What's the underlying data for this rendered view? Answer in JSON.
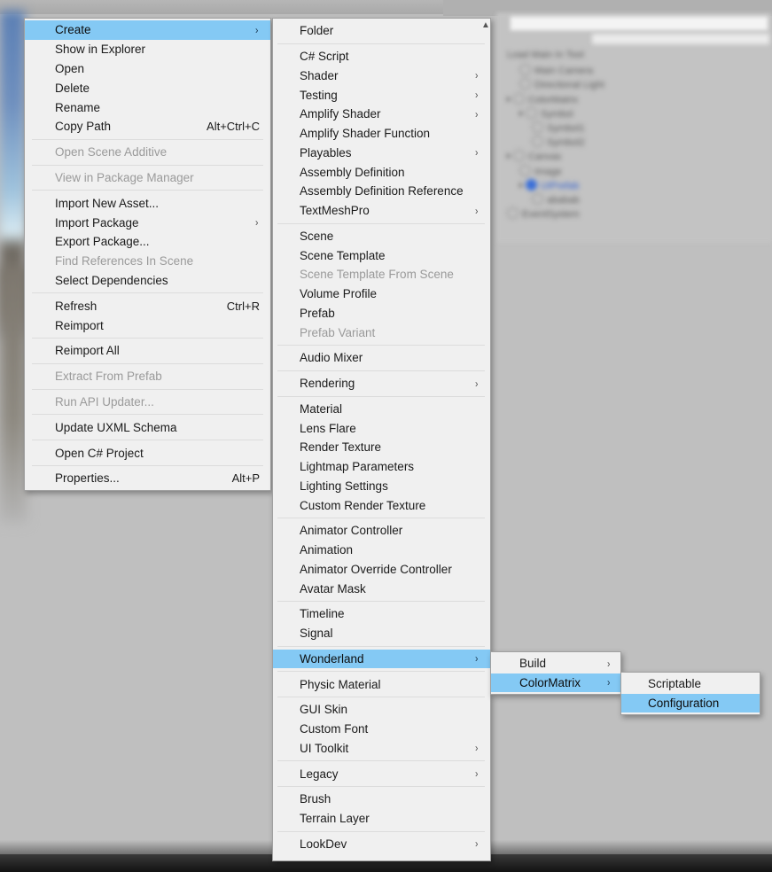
{
  "background": {
    "hierarchy_rows": [
      {
        "label": "Load Main In Tool",
        "indent": 0,
        "expand": false,
        "icon": false,
        "selected": false
      },
      {
        "label": "Main Camera",
        "indent": 1,
        "expand": false,
        "icon": true,
        "selected": false
      },
      {
        "label": "Directional Light",
        "indent": 1,
        "expand": false,
        "icon": true,
        "selected": false
      },
      {
        "label": "ColorMatrix",
        "indent": 0,
        "expand": true,
        "icon": true,
        "selected": false
      },
      {
        "label": "Symbol",
        "indent": 1,
        "expand": true,
        "icon": true,
        "selected": false
      },
      {
        "label": "Symbol1",
        "indent": 2,
        "expand": false,
        "icon": true,
        "selected": false
      },
      {
        "label": "Symbol2",
        "indent": 2,
        "expand": false,
        "icon": true,
        "selected": false
      },
      {
        "label": "Canvas",
        "indent": 0,
        "expand": true,
        "icon": true,
        "selected": false
      },
      {
        "label": "Image",
        "indent": 1,
        "expand": false,
        "icon": true,
        "selected": false
      },
      {
        "label": "UIPrefab",
        "indent": 1,
        "expand": true,
        "icon": true,
        "selected": true
      },
      {
        "label": "ababab",
        "indent": 2,
        "expand": false,
        "icon": true,
        "selected": false
      },
      {
        "label": "EventSystem",
        "indent": 0,
        "expand": false,
        "icon": true,
        "selected": false
      }
    ]
  },
  "colors": {
    "highlight": "#84c9f4",
    "menu_background": "#f0f0f0",
    "menu_border": "#a0a0a0",
    "text": "#1a1a1a",
    "text_disabled": "#9a9a9a",
    "separator": "#dcdcdc",
    "desktop_background": "#bfbfbf"
  },
  "icons": {
    "submenu_arrow": "submenu-arrow-icon",
    "scroll_up": "scroll-up-icon"
  },
  "glyphs": {
    "arrow": "›",
    "scroll_up": "▲"
  },
  "menu_asset": {
    "name": "Assets context menu",
    "items": [
      {
        "label": "Create",
        "highlighted": true,
        "submenu": true,
        "shortcut": "",
        "disabled": false
      },
      {
        "label": "Show in Explorer",
        "highlighted": false,
        "submenu": false,
        "shortcut": "",
        "disabled": false
      },
      {
        "label": "Open",
        "highlighted": false,
        "submenu": false,
        "shortcut": "",
        "disabled": false
      },
      {
        "label": "Delete",
        "highlighted": false,
        "submenu": false,
        "shortcut": "",
        "disabled": false
      },
      {
        "label": "Rename",
        "highlighted": false,
        "submenu": false,
        "shortcut": "",
        "disabled": false
      },
      {
        "label": "Copy Path",
        "highlighted": false,
        "submenu": false,
        "shortcut": "Alt+Ctrl+C",
        "disabled": false
      },
      {
        "separator": true
      },
      {
        "label": "Open Scene Additive",
        "highlighted": false,
        "submenu": false,
        "shortcut": "",
        "disabled": true
      },
      {
        "separator": true
      },
      {
        "label": "View in Package Manager",
        "highlighted": false,
        "submenu": false,
        "shortcut": "",
        "disabled": true
      },
      {
        "separator": true
      },
      {
        "label": "Import New Asset...",
        "highlighted": false,
        "submenu": false,
        "shortcut": "",
        "disabled": false
      },
      {
        "label": "Import Package",
        "highlighted": false,
        "submenu": true,
        "shortcut": "",
        "disabled": false
      },
      {
        "label": "Export Package...",
        "highlighted": false,
        "submenu": false,
        "shortcut": "",
        "disabled": false
      },
      {
        "label": "Find References In Scene",
        "highlighted": false,
        "submenu": false,
        "shortcut": "",
        "disabled": true
      },
      {
        "label": "Select Dependencies",
        "highlighted": false,
        "submenu": false,
        "shortcut": "",
        "disabled": false
      },
      {
        "separator": true
      },
      {
        "label": "Refresh",
        "highlighted": false,
        "submenu": false,
        "shortcut": "Ctrl+R",
        "disabled": false
      },
      {
        "label": "Reimport",
        "highlighted": false,
        "submenu": false,
        "shortcut": "",
        "disabled": false
      },
      {
        "separator": true
      },
      {
        "label": "Reimport All",
        "highlighted": false,
        "submenu": false,
        "shortcut": "",
        "disabled": false
      },
      {
        "separator": true
      },
      {
        "label": "Extract From Prefab",
        "highlighted": false,
        "submenu": false,
        "shortcut": "",
        "disabled": true
      },
      {
        "separator": true
      },
      {
        "label": "Run API Updater...",
        "highlighted": false,
        "submenu": false,
        "shortcut": "",
        "disabled": true
      },
      {
        "separator": true
      },
      {
        "label": "Update UXML Schema",
        "highlighted": false,
        "submenu": false,
        "shortcut": "",
        "disabled": false
      },
      {
        "separator": true
      },
      {
        "label": "Open C# Project",
        "highlighted": false,
        "submenu": false,
        "shortcut": "",
        "disabled": false
      },
      {
        "separator": true
      },
      {
        "label": "Properties...",
        "highlighted": false,
        "submenu": false,
        "shortcut": "Alt+P",
        "disabled": false
      }
    ]
  },
  "menu_create": {
    "name": "Create submenu",
    "items": [
      {
        "label": "Folder",
        "highlighted": false,
        "submenu": false,
        "disabled": false
      },
      {
        "separator": true
      },
      {
        "label": "C# Script",
        "highlighted": false,
        "submenu": false,
        "disabled": false
      },
      {
        "label": "Shader",
        "highlighted": false,
        "submenu": true,
        "disabled": false
      },
      {
        "label": "Testing",
        "highlighted": false,
        "submenu": true,
        "disabled": false
      },
      {
        "label": "Amplify Shader",
        "highlighted": false,
        "submenu": true,
        "disabled": false
      },
      {
        "label": "Amplify Shader Function",
        "highlighted": false,
        "submenu": false,
        "disabled": false
      },
      {
        "label": "Playables",
        "highlighted": false,
        "submenu": true,
        "disabled": false
      },
      {
        "label": "Assembly Definition",
        "highlighted": false,
        "submenu": false,
        "disabled": false
      },
      {
        "label": "Assembly Definition Reference",
        "highlighted": false,
        "submenu": false,
        "disabled": false
      },
      {
        "label": "TextMeshPro",
        "highlighted": false,
        "submenu": true,
        "disabled": false
      },
      {
        "separator": true
      },
      {
        "label": "Scene",
        "highlighted": false,
        "submenu": false,
        "disabled": false
      },
      {
        "label": "Scene Template",
        "highlighted": false,
        "submenu": false,
        "disabled": false
      },
      {
        "label": "Scene Template From Scene",
        "highlighted": false,
        "submenu": false,
        "disabled": true
      },
      {
        "label": "Volume Profile",
        "highlighted": false,
        "submenu": false,
        "disabled": false
      },
      {
        "label": "Prefab",
        "highlighted": false,
        "submenu": false,
        "disabled": false
      },
      {
        "label": "Prefab Variant",
        "highlighted": false,
        "submenu": false,
        "disabled": true
      },
      {
        "separator": true
      },
      {
        "label": "Audio Mixer",
        "highlighted": false,
        "submenu": false,
        "disabled": false
      },
      {
        "separator": true
      },
      {
        "label": "Rendering",
        "highlighted": false,
        "submenu": true,
        "disabled": false
      },
      {
        "separator": true
      },
      {
        "label": "Material",
        "highlighted": false,
        "submenu": false,
        "disabled": false
      },
      {
        "label": "Lens Flare",
        "highlighted": false,
        "submenu": false,
        "disabled": false
      },
      {
        "label": "Render Texture",
        "highlighted": false,
        "submenu": false,
        "disabled": false
      },
      {
        "label": "Lightmap Parameters",
        "highlighted": false,
        "submenu": false,
        "disabled": false
      },
      {
        "label": "Lighting Settings",
        "highlighted": false,
        "submenu": false,
        "disabled": false
      },
      {
        "label": "Custom Render Texture",
        "highlighted": false,
        "submenu": false,
        "disabled": false
      },
      {
        "separator": true
      },
      {
        "label": "Animator Controller",
        "highlighted": false,
        "submenu": false,
        "disabled": false
      },
      {
        "label": "Animation",
        "highlighted": false,
        "submenu": false,
        "disabled": false
      },
      {
        "label": "Animator Override Controller",
        "highlighted": false,
        "submenu": false,
        "disabled": false
      },
      {
        "label": "Avatar Mask",
        "highlighted": false,
        "submenu": false,
        "disabled": false
      },
      {
        "separator": true
      },
      {
        "label": "Timeline",
        "highlighted": false,
        "submenu": false,
        "disabled": false
      },
      {
        "label": "Signal",
        "highlighted": false,
        "submenu": false,
        "disabled": false
      },
      {
        "separator": true
      },
      {
        "label": "Wonderland",
        "highlighted": true,
        "submenu": true,
        "disabled": false
      },
      {
        "separator": true
      },
      {
        "label": "Physic Material",
        "highlighted": false,
        "submenu": false,
        "disabled": false
      },
      {
        "separator": true
      },
      {
        "label": "GUI Skin",
        "highlighted": false,
        "submenu": false,
        "disabled": false
      },
      {
        "label": "Custom Font",
        "highlighted": false,
        "submenu": false,
        "disabled": false
      },
      {
        "label": "UI Toolkit",
        "highlighted": false,
        "submenu": true,
        "disabled": false
      },
      {
        "separator": true
      },
      {
        "label": "Legacy",
        "highlighted": false,
        "submenu": true,
        "disabled": false
      },
      {
        "separator": true
      },
      {
        "label": "Brush",
        "highlighted": false,
        "submenu": false,
        "disabled": false
      },
      {
        "label": "Terrain Layer",
        "highlighted": false,
        "submenu": false,
        "disabled": false
      },
      {
        "separator": true
      },
      {
        "label": "LookDev",
        "highlighted": false,
        "submenu": true,
        "disabled": false
      }
    ]
  },
  "menu_wonderland": {
    "name": "Wonderland submenu",
    "items": [
      {
        "label": "Build",
        "highlighted": false,
        "submenu": true,
        "disabled": false
      },
      {
        "label": "ColorMatrix",
        "highlighted": true,
        "submenu": true,
        "disabled": false
      }
    ]
  },
  "menu_colormatrix": {
    "name": "ColorMatrix submenu",
    "items": [
      {
        "label": "Scriptable",
        "highlighted": false,
        "submenu": false,
        "disabled": false
      },
      {
        "label": "Configuration",
        "highlighted": true,
        "submenu": false,
        "disabled": false
      }
    ]
  }
}
